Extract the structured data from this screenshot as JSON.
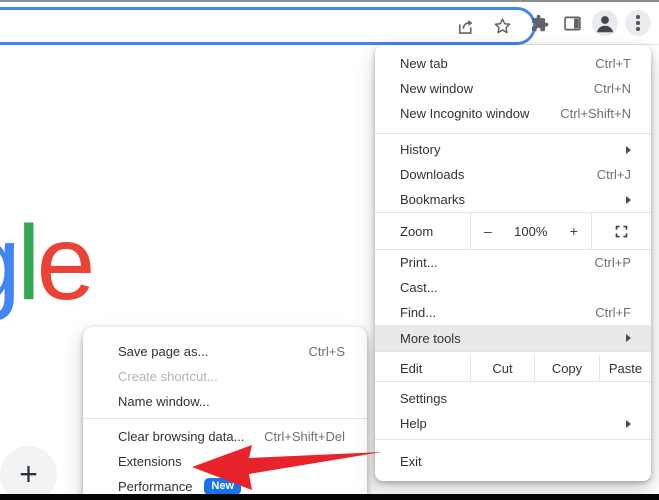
{
  "browser": {
    "address_bar": {
      "value": ""
    },
    "toolbar_icons": [
      "share-icon",
      "bookmark-star-icon",
      "extensions-puzzle-icon",
      "side-panel-icon",
      "profile-avatar-icon",
      "menu-three-dots-icon"
    ]
  },
  "page": {
    "google_logo_letters": {
      "first": "g",
      "second": "l",
      "third": "e"
    },
    "google_logo_colors": {
      "g": "#4285f4",
      "l": "#34a853",
      "e": "#ea4335"
    },
    "add_shortcut_label": "+"
  },
  "menu": {
    "new_tab": {
      "label": "New tab",
      "shortcut": "Ctrl+T"
    },
    "new_window": {
      "label": "New window",
      "shortcut": "Ctrl+N"
    },
    "new_incognito": {
      "label": "New Incognito window",
      "shortcut": "Ctrl+Shift+N"
    },
    "history": {
      "label": "History"
    },
    "downloads": {
      "label": "Downloads",
      "shortcut": "Ctrl+J"
    },
    "bookmarks": {
      "label": "Bookmarks"
    },
    "zoom": {
      "label": "Zoom",
      "zoom_out": "–",
      "level": "100%",
      "zoom_in": "+"
    },
    "print": {
      "label": "Print...",
      "shortcut": "Ctrl+P"
    },
    "cast": {
      "label": "Cast..."
    },
    "find": {
      "label": "Find...",
      "shortcut": "Ctrl+F"
    },
    "more_tools": {
      "label": "More tools"
    },
    "edit": {
      "label": "Edit",
      "cut": "Cut",
      "copy": "Copy",
      "paste": "Paste"
    },
    "settings": {
      "label": "Settings"
    },
    "help": {
      "label": "Help"
    },
    "exit": {
      "label": "Exit"
    }
  },
  "submenu": {
    "save_page_as": {
      "label": "Save page as...",
      "shortcut": "Ctrl+S"
    },
    "create_shortcut": {
      "label": "Create shortcut..."
    },
    "name_window": {
      "label": "Name window..."
    },
    "clear_browsing_data": {
      "label": "Clear browsing data...",
      "shortcut": "Ctrl+Shift+Del"
    },
    "extensions": {
      "label": "Extensions"
    },
    "performance": {
      "label": "Performance",
      "badge": "New"
    }
  },
  "colors": {
    "omnibox_focus": "#4285f4",
    "badge_blue": "#1a73e8",
    "annotation_arrow_red": "#e8232b",
    "menu_highlight": "#e9e9e9"
  }
}
